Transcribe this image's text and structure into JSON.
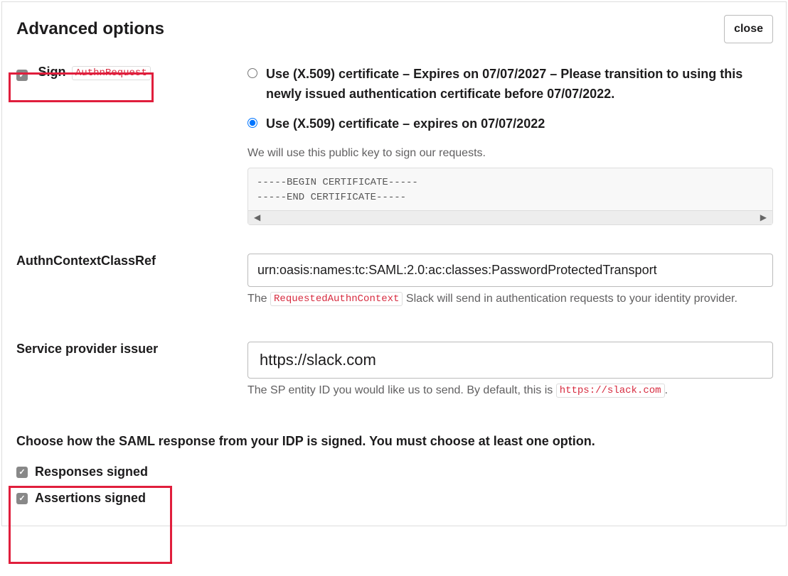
{
  "header": {
    "title": "Advanced options",
    "close_label": "close"
  },
  "sign_authn": {
    "label_prefix": "Sign",
    "label_code": "AuthnRequest",
    "checked": true,
    "radio_option_1": "Use (X.509) certificate – Expires on 07/07/2027 – Please transition to using this newly issued authentication certificate before 07/07/2022.",
    "radio_option_2": "Use (X.509) certificate – expires on 07/07/2022",
    "selected_option": 2,
    "helper": "We will use this public key to sign our requests.",
    "certificate_text": "-----BEGIN CERTIFICATE-----\n-----END CERTIFICATE-----"
  },
  "authn_context": {
    "label": "AuthnContextClassRef",
    "value": "urn:oasis:names:tc:SAML:2.0:ac:classes:PasswordProtectedTransport",
    "helper_prefix": "The ",
    "helper_code": "RequestedAuthnContext",
    "helper_suffix": " Slack will send in authentication requests to your identity provider."
  },
  "sp_issuer": {
    "label": "Service provider issuer",
    "value": "https://slack.com",
    "helper_prefix": "The SP entity ID you would like us to send. By default, this is ",
    "helper_code": "https://slack.com",
    "helper_suffix": "."
  },
  "saml_sign": {
    "heading": "Choose how the SAML response from your IDP is signed. You must choose at least one option.",
    "responses_signed_label": "Responses signed",
    "responses_signed_checked": true,
    "assertions_signed_label": "Assertions signed",
    "assertions_signed_checked": true
  }
}
